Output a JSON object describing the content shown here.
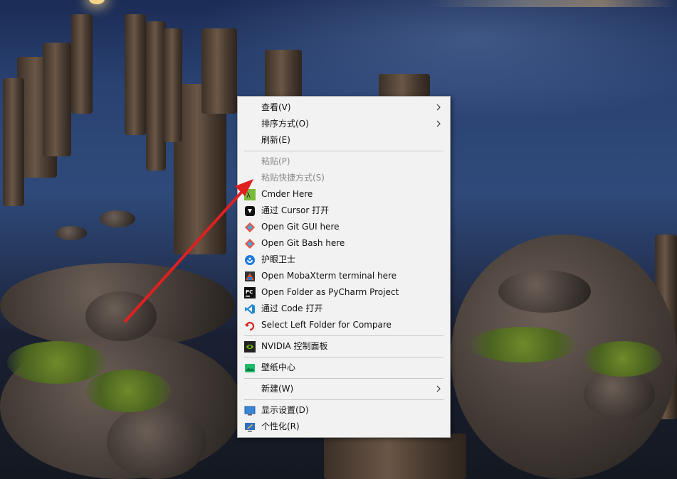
{
  "desktop": {
    "wallpaper": "pier-at-dusk"
  },
  "context_menu": {
    "items": [
      {
        "label": "查看(V)",
        "submenu": true,
        "icon": "none"
      },
      {
        "label": "排序方式(O)",
        "submenu": true,
        "icon": "none"
      },
      {
        "label": "刷新(E)",
        "submenu": false,
        "icon": "none"
      },
      {
        "label": "粘贴(P)",
        "disabled": true,
        "icon": "none"
      },
      {
        "label": "粘贴快捷方式(S)",
        "disabled": true,
        "icon": "none"
      },
      {
        "label": "Cmder Here",
        "icon": "cmder-icon"
      },
      {
        "label": "通过 Cursor 打开",
        "icon": "cursor-icon"
      },
      {
        "label": "Open Git GUI here",
        "icon": "git-gui-icon"
      },
      {
        "label": "Open Git Bash here",
        "icon": "git-bash-icon"
      },
      {
        "label": "护眼卫士",
        "icon": "eye-guard-icon"
      },
      {
        "label": "Open MobaXterm terminal here",
        "icon": "mobaxterm-icon"
      },
      {
        "label": "Open Folder as PyCharm Project",
        "icon": "pycharm-icon"
      },
      {
        "label": "通过 Code 打开",
        "icon": "vscode-icon"
      },
      {
        "label": "Select Left Folder for Compare",
        "icon": "compare-icon"
      },
      {
        "label": "NVIDIA 控制面板",
        "icon": "nvidia-icon"
      },
      {
        "label": "壁纸中心",
        "icon": "wallpaper-center-icon"
      },
      {
        "label": "新建(W)",
        "submenu": true,
        "icon": "none"
      },
      {
        "label": "显示设置(D)",
        "icon": "display-settings-icon"
      },
      {
        "label": "个性化(R)",
        "icon": "personalize-icon"
      }
    ]
  },
  "annotation": {
    "color": "#e02020",
    "type": "arrow"
  },
  "colors": {
    "menu_bg": "#f2f2f2",
    "disabled_text": "#8a8a8a",
    "arrow_red": "#e02020"
  }
}
